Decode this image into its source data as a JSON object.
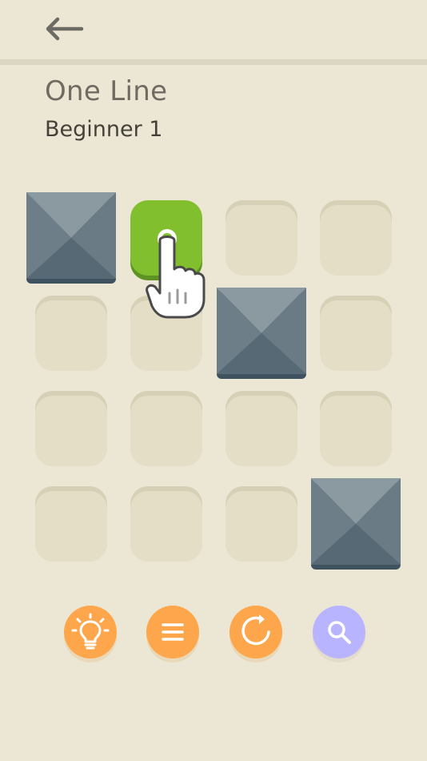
{
  "header": {
    "back_icon": "back-arrow-icon"
  },
  "level": {
    "title": "One Line",
    "subtitle": "Beginner 1"
  },
  "board": {
    "rows": 4,
    "cols": 4,
    "cells": [
      [
        "block",
        "active",
        "empty",
        "empty"
      ],
      [
        "empty",
        "empty",
        "block",
        "empty"
      ],
      [
        "empty",
        "empty",
        "empty",
        "empty"
      ],
      [
        "empty",
        "empty",
        "empty",
        "block"
      ]
    ],
    "colors": {
      "empty": "#e4dec6",
      "active": "#82bf2f",
      "block": "#667985"
    }
  },
  "toolbar": {
    "buttons": [
      {
        "name": "hint-button",
        "icon": "lightbulb-icon",
        "color": "#fda64b"
      },
      {
        "name": "menu-button",
        "icon": "menu-icon",
        "color": "#fda64b"
      },
      {
        "name": "restart-button",
        "icon": "restart-icon",
        "color": "#fda64b"
      },
      {
        "name": "zoom-button",
        "icon": "search-icon",
        "color": "#b9b4ff"
      }
    ]
  },
  "tutorial": {
    "icon": "tap-hand-icon"
  }
}
